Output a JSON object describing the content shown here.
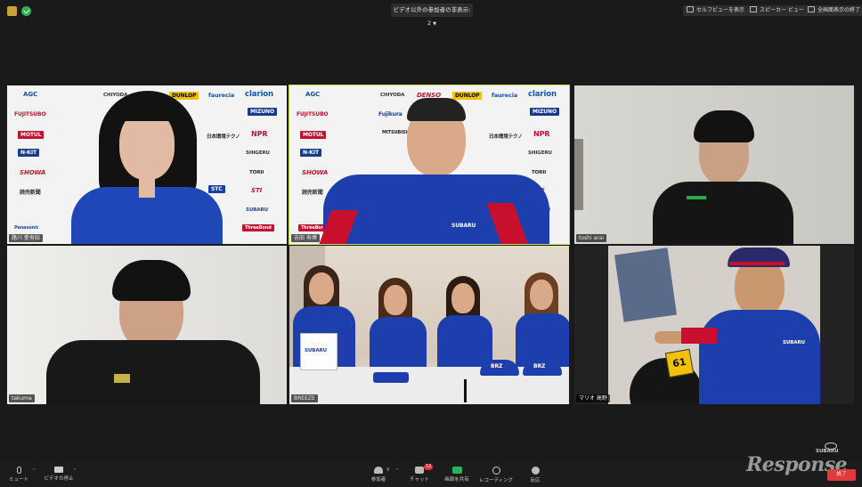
{
  "topbar": {
    "participants_dropdown": "ビデオ以外の参加者の非表示: 2",
    "self_view_button": "セルフビューを表示",
    "speaker_view_button": "スピーカー ビュー",
    "exit_fullscreen_button": "全画面表示の終了"
  },
  "tiles": [
    {
      "name": "路川 愛寿知"
    },
    {
      "name": "吉田 寿博"
    },
    {
      "name": "toshi arai"
    },
    {
      "name": "takuma"
    },
    {
      "name": "BREEZE"
    },
    {
      "name": "マリオ 高野"
    }
  ],
  "sponsors": {
    "row1": [
      "AGC",
      "CHIYODA",
      "DUNLOP",
      "faurecia",
      "clarion"
    ],
    "row2": [
      "FUJITSUBO",
      "Fujikura",
      "MIZUNO"
    ],
    "row3": [
      "MOTUL",
      "NPR",
      "日本環境テクノ"
    ],
    "row4": [
      "N-KIT",
      "SHIGERU"
    ],
    "row5": [
      "SHOWA",
      "TORII"
    ],
    "row6": [
      "読売新聞",
      "STC",
      "STI"
    ],
    "row7": [
      "SUBARU",
      "Panasonic",
      "ThreeBond"
    ],
    "denso": "DENSO",
    "mitsubishi": "MITSUBISHI CHEMICAL"
  },
  "breeze": {
    "sign_text": "SUBARU",
    "cap_text": "BRZ",
    "car_number": "61"
  },
  "bottombar": {
    "mute": "ミュート",
    "video": "ビデオの停止",
    "participants": "参加者",
    "participants_count": "9",
    "chat": "チャット",
    "chat_badge": "12",
    "share": "画面を共有",
    "record": "レコーディング",
    "reactions": "反応",
    "end": "終了"
  },
  "watermark": {
    "brand": "Response",
    "subaru": "SUBARU"
  },
  "colors": {
    "active_border": "#c9e34a",
    "share_green": "#27b35a",
    "end_red": "#e03a3a",
    "subaru_blue": "#1a3da8"
  }
}
